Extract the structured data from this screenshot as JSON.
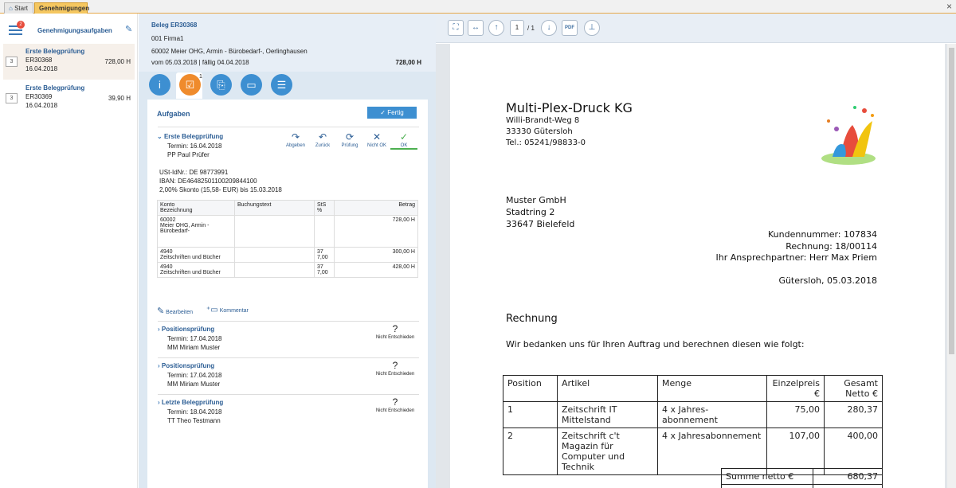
{
  "tabs": {
    "start": "Start",
    "active": "Genehmigungen"
  },
  "left": {
    "title": "Genehmigungsaufgaben",
    "badge": "2",
    "tasks": [
      {
        "num": "3",
        "title": "Erste Belegprüfung",
        "nr": "ER30368",
        "date": "16.04.2018",
        "amount": "728,00 H"
      },
      {
        "num": "3",
        "title": "Erste Belegprüfung",
        "nr": "ER30369",
        "date": "16.04.2018",
        "amount": "39,90 H"
      }
    ]
  },
  "beleg": {
    "title": "Beleg ER30368",
    "firma": "001 Firma1",
    "partner": "60002 Meier OHG, Armin - Bürobedarf-, Oerlinghausen",
    "dates": "vom 05.03.2018 | fällig 04.04.2018",
    "amount": "728,00 H",
    "tab_count": "1"
  },
  "aufgaben": {
    "title": "Aufgaben",
    "fertig": "Fertig",
    "current": {
      "title": "Erste Belegprüfung",
      "termin": "Termin: 16.04.2018",
      "person": "PP Paul Prüfer"
    },
    "actions": [
      "Abgeben",
      "Zurück",
      "Prüfung",
      "Nicht OK",
      "OK"
    ],
    "info": [
      "USt-IdNr.: DE 98773991",
      "IBAN: DE46482501100209844100",
      "2,00% Skonto (15,58- EUR) bis 15.03.2018"
    ],
    "table": {
      "headers": {
        "konto": "Konto",
        "bezeichnung": "Bezeichnung",
        "text": "Buchungstext",
        "sts": "StS",
        "pct": "%",
        "betrag": "Betrag"
      },
      "rows": [
        {
          "konto": "60002",
          "bez": "Meier OHG, Armin - Bürobedarf-",
          "text": "",
          "sts": "",
          "pct": "",
          "betrag": "728,00 H"
        },
        {
          "konto": "4940",
          "bez": "Zeitschriften und Bücher",
          "text": "",
          "sts": "37",
          "pct": "7,00",
          "betrag": "300,00 H"
        },
        {
          "konto": "4940",
          "bez": "Zeitschriften und Bücher",
          "text": "",
          "sts": "37",
          "pct": "7,00",
          "betrag": "428,00 H"
        }
      ]
    },
    "bearbeiten": "Bearbeiten",
    "kommentar": "Kommentar",
    "others": [
      {
        "title": "Positionsprüfung",
        "termin": "Termin: 17.04.2018",
        "person": "MM Miriam Muster",
        "state": "Nicht Entschieden",
        "q": "?"
      },
      {
        "title": "Positionsprüfung",
        "termin": "Termin: 17.04.2018",
        "person": "MM Miriam Muster",
        "state": "Nicht Entschieden",
        "q": "?"
      },
      {
        "title": "Letzte Belegprüfung",
        "termin": "Termin: 18.04.2018",
        "person": "TT Theo Testmann",
        "state": "Nicht Entschieden",
        "q": "?"
      }
    ]
  },
  "viewer": {
    "page": "1",
    "pages": "/ 1",
    "pdf": "PDF"
  },
  "invoice": {
    "company": "Multi-Plex-Druck KG",
    "street": "Willi-Brandt-Weg 8",
    "city": "33330 Gütersloh",
    "tel": "Tel.: 05241/98833-0",
    "recipient": [
      "Muster GmbH",
      "Stadtring 2",
      "33647 Bielefeld"
    ],
    "kunde": "Kundennummer: 107834",
    "rechnung": "Rechnung: 18/00114",
    "ansprech": "Ihr Ansprechpartner: Herr Max Priem",
    "ortdatum": "Gütersloh, 05.03.2018",
    "heading": "Rechnung",
    "intro": "Wir bedanken uns für Ihren Auftrag und berechnen diesen wie folgt:",
    "cols": [
      "Position",
      "Artikel",
      "Menge",
      "Einzelpreis €",
      "Gesamt Netto €"
    ],
    "rows": [
      {
        "pos": "1",
        "art": "Zeitschrift IT Mittelstand",
        "menge": "4 x Jahres-abonnement",
        "ep": "75,00",
        "gesamt": "280,37"
      },
      {
        "pos": "2",
        "art": "Zeitschrift c't Magazin für Computer und Technik",
        "menge": "4 x Jahresabonnement",
        "ep": "107,00",
        "gesamt": "400,00"
      }
    ],
    "summe_label": "Summe netto €",
    "summe": "680,37"
  },
  "colors": {
    "accent": "#3d8fd1",
    "active_tab": "#f5c760",
    "orange": "#ef8b2c"
  }
}
